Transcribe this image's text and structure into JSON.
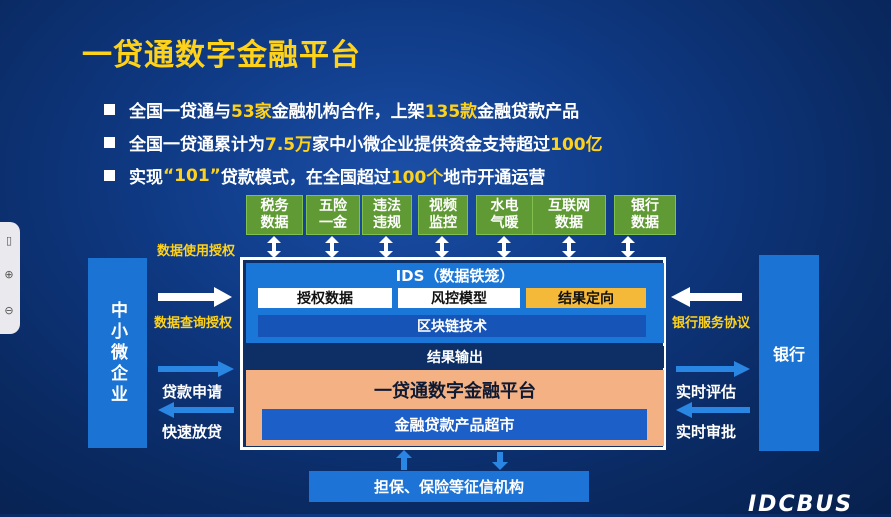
{
  "title": "一贷通数字金融平台",
  "bullets": [
    {
      "p1": "全国一贷通与",
      "h1": "53家",
      "p2": "金融机构合作，上架",
      "h2": "135款",
      "p3": "金融贷款产品"
    },
    {
      "p1": "全国一贷通累计为",
      "h1": "7.5万",
      "p2": "家中小微企业提供资金支持超过",
      "h2": "100亿",
      "p3": ""
    },
    {
      "p1": "实现",
      "h1": "“101”",
      "p2": "贷款模式，在全国超过",
      "h2": "100个",
      "p3": "地市开通运营"
    }
  ],
  "sources": [
    "税务\n数据",
    "五险\n一金",
    "违法\n违规",
    "视频\n监控",
    "水电\n气暖",
    "互联网\n数据",
    "银行\n数据"
  ],
  "left_entity": "中小微企业",
  "right_entity": "银行",
  "ids_title": "IDS（数据铁笼）",
  "ids_boxes": [
    "授权数据",
    "风控模型",
    "结果定向"
  ],
  "blockchain": "区块链技术",
  "result_output": "结果输出",
  "platform_title": "一贷通数字金融平台",
  "market": "金融贷款产品超市",
  "credit": "担保、保险等征信机构",
  "labels": {
    "data_use_auth": "数据使用授权",
    "data_query_auth": "数据查询授权",
    "bank_service": "银行服务协议",
    "loan_apply": "贷款申请",
    "fast_loan": "快速放贷",
    "realtime_eval": "实时评估",
    "realtime_approve": "实时审批"
  },
  "watermark": "IDCBUS",
  "colors": {
    "accent": "#ffd21a",
    "source_green": "#5f9a34",
    "blue_box": "#1b74d4",
    "platform": "#f4b183",
    "result_box": "#f5b93a"
  }
}
